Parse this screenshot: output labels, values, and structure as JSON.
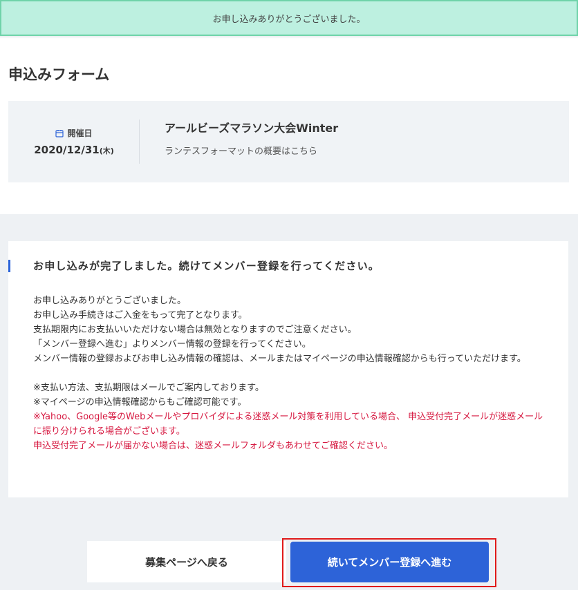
{
  "banner": {
    "text": "お申し込みありがとうございました。"
  },
  "page": {
    "title": "申込みフォーム"
  },
  "event": {
    "date_label": "開催日",
    "date_value": "2020/12/31",
    "date_dow": "(木)",
    "name": "アールビーズマラソン大会Winter",
    "description": "ランテスフォーマットの概要はこちら"
  },
  "message": {
    "heading": "お申し込みが完了しました。続けてメンバー登録を行ってください。",
    "lines": [
      "お申し込みありがとうございました。",
      "お申し込み手続きはご入金をもって完了となります。",
      "支払期限内にお支払いいただけない場合は無効となりますのでご注意ください。",
      "「メンバー登録へ進む」よりメンバー情報の登録を行ってください。",
      "メンバー情報の登録およびお申し込み情報の確認は、メールまたはマイページの申込情報確認からも行っていただけます。",
      "※支払い方法、支払期限はメールでご案内しております。",
      "※マイページの申込情報確認からもご確認可能です。"
    ],
    "warnings": [
      "※Yahoo、Google等のWebメールやプロバイダによる迷惑メール対策を利用している場合、 申込受付完了メールが迷惑メールに振り分けられる場合がございます。",
      "申込受付完了メールが届かない場合は、迷惑メールフォルダもあわせてご確認ください。"
    ]
  },
  "buttons": {
    "back_label": "募集ページへ戻る",
    "next_label": "続いてメンバー登録へ進む"
  },
  "icons": {
    "date": "calendar-icon"
  },
  "colors": {
    "banner_bg": "#bdf0e0",
    "accent": "#2d63d8",
    "warning": "#d6173f",
    "highlight_frame": "#e01a1a"
  }
}
